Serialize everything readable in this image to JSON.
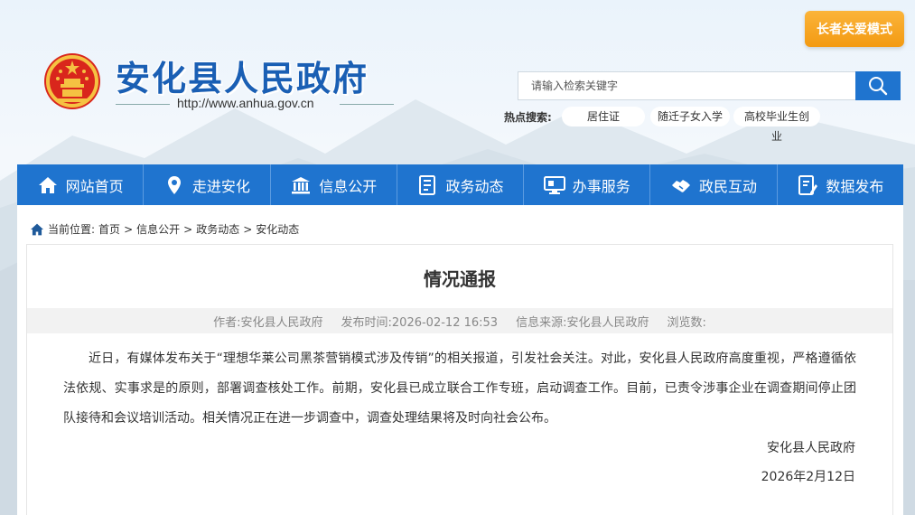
{
  "header": {
    "site_title": "安化县人民政府",
    "site_url": "http://www.anhua.gov.cn",
    "elder_mode_label": "长者关爱模式",
    "search_placeholder": "请输入检索关键字",
    "hot_search_label": "热点搜索:",
    "hot_tags": [
      "居住证",
      "随迁子女入学",
      "高校毕业生创业"
    ]
  },
  "nav": {
    "items": [
      {
        "label": "网站首页",
        "icon": "home-icon"
      },
      {
        "label": "走进安化",
        "icon": "location-pin-icon"
      },
      {
        "label": "信息公开",
        "icon": "government-building-icon"
      },
      {
        "label": "政务动态",
        "icon": "document-list-icon"
      },
      {
        "label": "办事服务",
        "icon": "monitor-icon"
      },
      {
        "label": "政民互动",
        "icon": "handshake-icon"
      },
      {
        "label": "数据发布",
        "icon": "data-report-icon"
      }
    ]
  },
  "breadcrumb": {
    "label": "当前位置:",
    "items": [
      "首页",
      "信息公开",
      "政务动态",
      "安化动态"
    ],
    "separator": ">"
  },
  "article": {
    "title": "情况通报",
    "meta": {
      "author": "作者:安化县人民政府",
      "published": "发布时间:2026-02-12 16:53",
      "source": "信息来源:安化县人民政府",
      "views": "浏览数:"
    },
    "body": "近日，有媒体发布关于“理想华莱公司黑茶营销模式涉及传销”的相关报道，引发社会关注。对此，安化县人民政府高度重视，严格遵循依法依规、实事求是的原则，部署调查核处工作。前期，安化县已成立联合工作专班，启动调查工作。目前，已责令涉事企业在调查期间停止团队接待和会议培训活动。相关情况正在进一步调查中，调查处理结果将及时向社会公布。",
    "signature_org": "安化县人民政府",
    "signature_date": "2026年2月12日"
  },
  "colors": {
    "nav_blue": "#1f74cf",
    "elder_button": "#f39a12",
    "title_blue": "#1a5fb4"
  }
}
